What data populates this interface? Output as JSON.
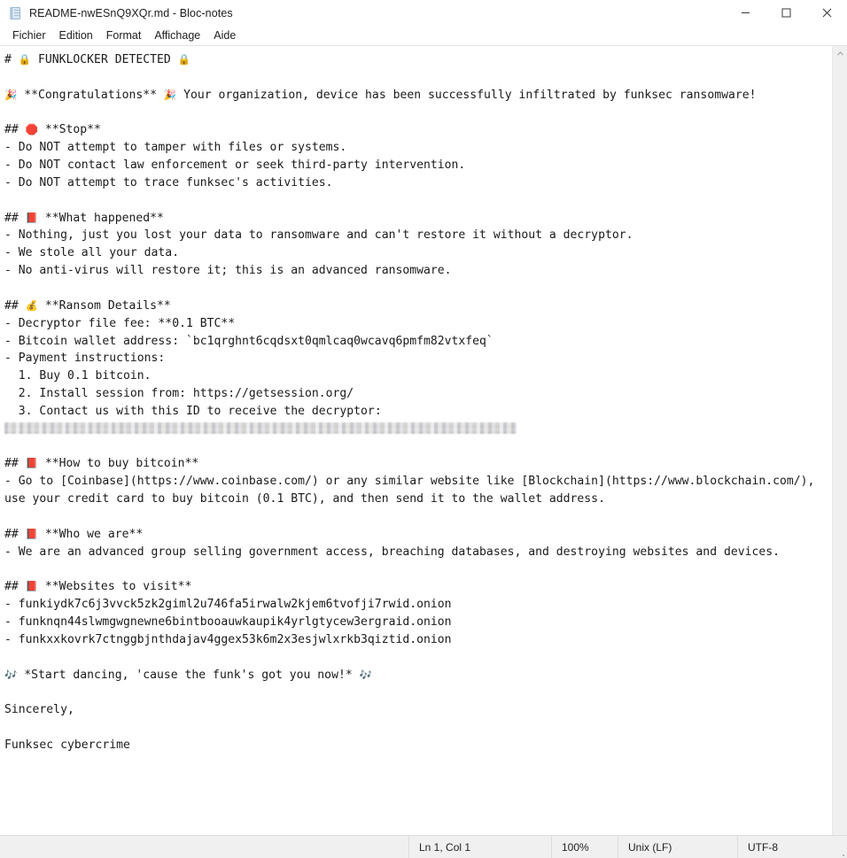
{
  "window": {
    "title": "README-nwESnQ9XQr.md - Bloc-notes",
    "icon": "notepad-document-icon",
    "controls": {
      "minimize": "minimize-button",
      "maximize": "maximize-button",
      "close": "close-button"
    }
  },
  "menubar": {
    "items": [
      {
        "label": "Fichier"
      },
      {
        "label": "Edition"
      },
      {
        "label": "Format"
      },
      {
        "label": "Affichage"
      },
      {
        "label": "Aide"
      }
    ]
  },
  "document": {
    "lines": [
      {
        "id": "l01",
        "text": "# 🔒 FUNKLOCKER DETECTED 🔒"
      },
      {
        "id": "l02",
        "text": ""
      },
      {
        "id": "l03",
        "text": "🎉 **Congratulations** 🎉 Your organization, device has been successfully infiltrated by funksec ransomware!"
      },
      {
        "id": "l04",
        "text": ""
      },
      {
        "id": "l05",
        "text": "## 🛑 **Stop**"
      },
      {
        "id": "l06",
        "text": "- Do NOT attempt to tamper with files or systems."
      },
      {
        "id": "l07",
        "text": "- Do NOT contact law enforcement or seek third-party intervention."
      },
      {
        "id": "l08",
        "text": "- Do NOT attempt to trace funksec's activities."
      },
      {
        "id": "l09",
        "text": ""
      },
      {
        "id": "l10",
        "text": "## 📕 **What happened**"
      },
      {
        "id": "l11",
        "text": "- Nothing, just you lost your data to ransomware and can't restore it without a decryptor."
      },
      {
        "id": "l12",
        "text": "- We stole all your data."
      },
      {
        "id": "l13",
        "text": "- No anti-virus will restore it; this is an advanced ransomware."
      },
      {
        "id": "l14",
        "text": ""
      },
      {
        "id": "l15",
        "text": "## 💰 **Ransom Details**"
      },
      {
        "id": "l16",
        "text": "- Decryptor file fee: **0.1 BTC**"
      },
      {
        "id": "l17",
        "text": "- Bitcoin wallet address: `bc1qrghnt6cqdsxt0qmlcaq0wcavq6pmfm82vtxfeq`"
      },
      {
        "id": "l18",
        "text": "- Payment instructions:"
      },
      {
        "id": "l19",
        "text": "  1. Buy 0.1 bitcoin."
      },
      {
        "id": "l20",
        "text": "  2. Install session from: https://getsession.org/"
      },
      {
        "id": "l21",
        "text": "  3. Contact us with this ID to receive the decryptor:"
      },
      {
        "id": "l22",
        "text": "",
        "redacted": true
      },
      {
        "id": "l23",
        "text": ""
      },
      {
        "id": "l24",
        "text": "## 📕 **How to buy bitcoin**"
      },
      {
        "id": "l25",
        "text": "- Go to [Coinbase](https://www.coinbase.com/) or any similar website like [Blockchain](https://www.blockchain.com/), use your credit card to buy bitcoin (0.1 BTC), and then send it to the wallet address."
      },
      {
        "id": "l26",
        "text": ""
      },
      {
        "id": "l27",
        "text": "## 📕 **Who we are**"
      },
      {
        "id": "l28",
        "text": "- We are an advanced group selling government access, breaching databases, and destroying websites and devices."
      },
      {
        "id": "l29",
        "text": ""
      },
      {
        "id": "l30",
        "text": "## 📕 **Websites to visit**"
      },
      {
        "id": "l31",
        "text": "- funkiydk7c6j3vvck5zk2giml2u746fa5irwalw2kjem6tvofji7rwid.onion"
      },
      {
        "id": "l32",
        "text": "- funknqn44slwmgwgnewne6bintbooauwkaupik4yrlgtycew3ergraid.onion"
      },
      {
        "id": "l33",
        "text": "- funkxxkovrk7ctnggbjnthdajav4ggex53k6m2x3esjwlxrkb3qiztid.onion"
      },
      {
        "id": "l34",
        "text": ""
      },
      {
        "id": "l35",
        "text": "🎶 *Start dancing, 'cause the funk's got you now!* 🎶"
      },
      {
        "id": "l36",
        "text": ""
      },
      {
        "id": "l37",
        "text": "Sincerely,"
      },
      {
        "id": "l38",
        "text": ""
      },
      {
        "id": "l39",
        "text": "Funksec cybercrime"
      }
    ]
  },
  "statusbar": {
    "position": "Ln 1, Col 1",
    "zoom": "100%",
    "line_ending": "Unix (LF)",
    "encoding": "UTF-8"
  },
  "colors": {
    "window_bg": "#ffffff",
    "text": "#1a1a1a",
    "statusbar_bg": "#f0f0f0",
    "scrollbar_bg": "#f0f0f0",
    "close_hover": "#e81123"
  }
}
